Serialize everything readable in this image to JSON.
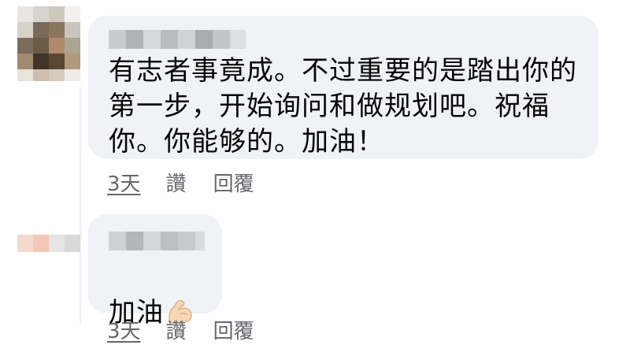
{
  "comments": [
    {
      "text": "有志者事竟成。不过重要的是踏出你的\n第一步，开始询问和做规划吧。祝福\n你。你能够的。加油！",
      "time_label": "3天",
      "like_label": "讚",
      "reply_label": "回覆",
      "avatar_icon": "blurred-avatar"
    },
    {
      "text": "加油",
      "emoji_icon": "flexed-biceps-icon",
      "time_label": "3天",
      "like_label": "讚",
      "reply_label": "回覆",
      "avatar_icon": "blurred-avatar"
    }
  ],
  "colors": {
    "bubble": "#f0f2f5",
    "text": "#050505",
    "secondary": "#65676b"
  }
}
